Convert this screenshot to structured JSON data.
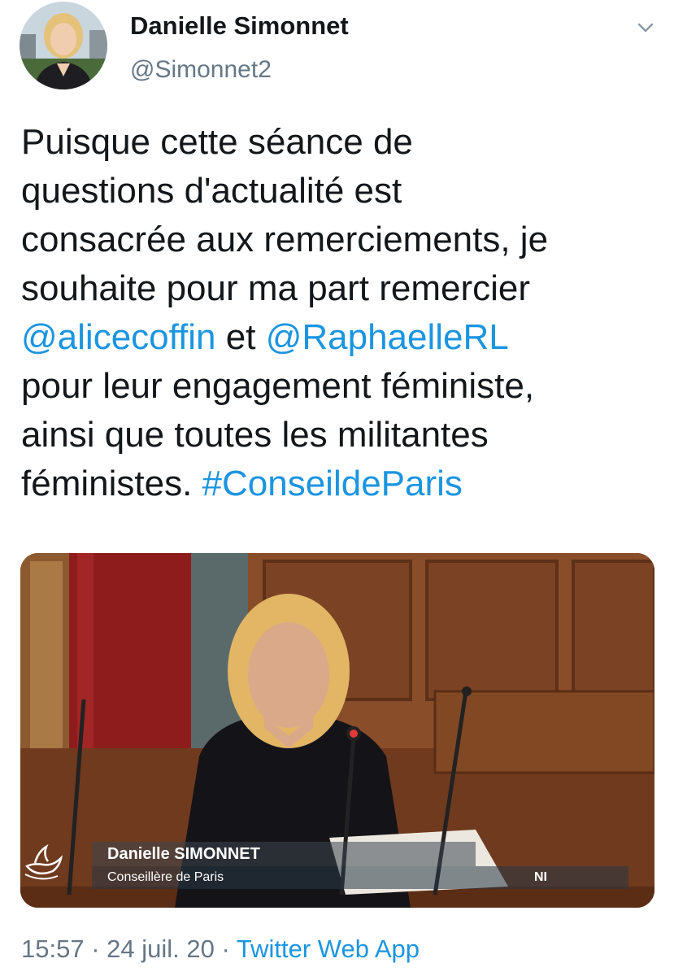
{
  "tweet": {
    "author": {
      "display_name": "Danielle Simonnet",
      "handle": "@Simonnet2",
      "avatar_icon": "profile-photo"
    },
    "menu_icon": "chevron-down-icon",
    "text_segments": [
      {
        "text": "Puisque cette séance de"
      },
      {
        "text": "questions d'actualité est"
      },
      {
        "text": "consacrée aux remerciements, je"
      },
      {
        "text": "souhaite pour ma part remercier"
      },
      {
        "mention1": "@alicecoffin",
        "middle": " et ",
        "mention2": "@RaphaelleRL"
      },
      {
        "text": "pour leur engagement féministe,"
      },
      {
        "text": "ainsi que toutes les militantes"
      },
      {
        "text": "féministes. ",
        "hashtag": "#ConseildeParis"
      }
    ],
    "media": {
      "lower_third_name": "Danielle SIMONNET",
      "lower_third_role": "Conseillère de Paris",
      "lower_third_party": "NI"
    },
    "footer": {
      "time": "15:57",
      "separator1": " · ",
      "date": "24 juil. 20",
      "separator2": " · ",
      "source": "Twitter Web App"
    }
  },
  "colors": {
    "link": "#1b95e0",
    "text": "#14171a",
    "muted": "#657786"
  }
}
